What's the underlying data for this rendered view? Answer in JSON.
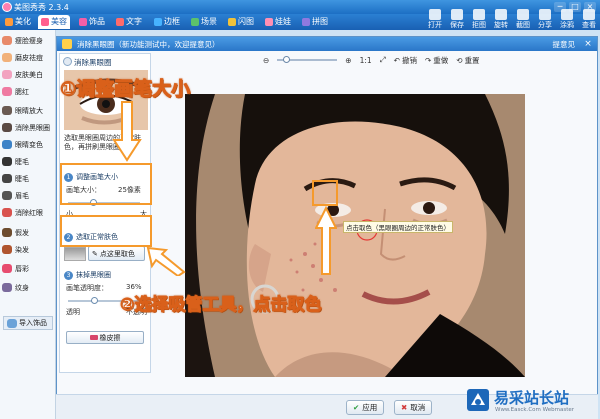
{
  "app": {
    "title": "美图秀秀 2.3.4"
  },
  "window_controls": [
    "─",
    "□",
    "×"
  ],
  "menu_tabs": [
    {
      "label": "美化",
      "color": "#ff9a3c",
      "active": false
    },
    {
      "label": "美容",
      "color": "#ff5f8f",
      "active": true
    },
    {
      "label": "饰品",
      "color": "#f35fa7",
      "active": false
    },
    {
      "label": "文字",
      "color": "#ff6b6b",
      "active": false
    },
    {
      "label": "边框",
      "color": "#47b3ff",
      "active": false
    },
    {
      "label": "场景",
      "color": "#5cc26b",
      "active": false
    },
    {
      "label": "闪图",
      "color": "#f1c23a",
      "active": false
    },
    {
      "label": "娃娃",
      "color": "#ff8fb3",
      "active": false
    },
    {
      "label": "拼图",
      "color": "#8f79e0",
      "active": false
    }
  ],
  "toolbar_tools": [
    "打开",
    "保存",
    "拒图",
    "旋转",
    "截图",
    "分享",
    "涂鸦",
    "查看"
  ],
  "sidebar": [
    {
      "label": "瘦脸瘦身",
      "color": "#e88a6a"
    },
    {
      "label": "磨皮祛痘",
      "color": "#f1b17a"
    },
    {
      "label": "皮肤美白",
      "color": "#f2a3c0"
    },
    {
      "label": "腮红",
      "color": "#ef7aa2"
    },
    {
      "label": "眼睛放大",
      "color": "#6a5a52"
    },
    {
      "label": "消除黑眼圈",
      "color": "#5a4a44"
    },
    {
      "label": "眼睛变色",
      "color": "#3c82c7"
    },
    {
      "label": "睫毛",
      "color": "#333333"
    },
    {
      "label": "睫毛",
      "color": "#444444"
    },
    {
      "label": "眉毛",
      "color": "#555555"
    },
    {
      "label": "消除红眼",
      "color": "#d9534f"
    },
    {
      "label": "假发",
      "color": "#6d4c2f"
    },
    {
      "label": "染发",
      "color": "#b0552f"
    },
    {
      "label": "唇彩",
      "color": "#e74c6f"
    },
    {
      "label": "纹身",
      "color": "#7a6a9c"
    }
  ],
  "sidebar_import": "导入饰品",
  "dialog": {
    "title": "消除黑眼圈（新功能测试中，欢迎提意见）",
    "feedback": "提意见",
    "close": "×"
  },
  "panel": {
    "title": "消除黑眼圈",
    "desc": "选取黑眼圈周边的正常肤色，再拼刷黑眼圈",
    "section1": {
      "num": "1",
      "title": "调整画笔大小",
      "label": "画笔大小：",
      "value": "25像素",
      "min": "小",
      "max": "大",
      "fraction": 0.35
    },
    "section2": {
      "num": "2",
      "title": "选取正常肤色",
      "button": "点这里取色"
    },
    "section3": {
      "num": "3",
      "title": "抹掉黑眼圈",
      "label": "画笔透明度：",
      "value": "36%",
      "min": "透明",
      "max": "不透明",
      "fraction": 0.36
    },
    "eraser": "橡皮擦"
  },
  "canvas_toolbar": {
    "zoom_ratio": "1:1",
    "undo": "撤销",
    "redo": "重做",
    "reset": "重置"
  },
  "tooltip": "点击取色（黑眼圈周边的正常肤色）",
  "footer": {
    "apply": "应用",
    "cancel": "取消"
  },
  "annotations": {
    "step1": "①调整画笔大小",
    "step2": "②选择吸管工具，点击取色",
    "color": "#f59a2c"
  },
  "watermark": {
    "name": "易采站长站",
    "url": "Www.Easck.Com Webmaster"
  }
}
